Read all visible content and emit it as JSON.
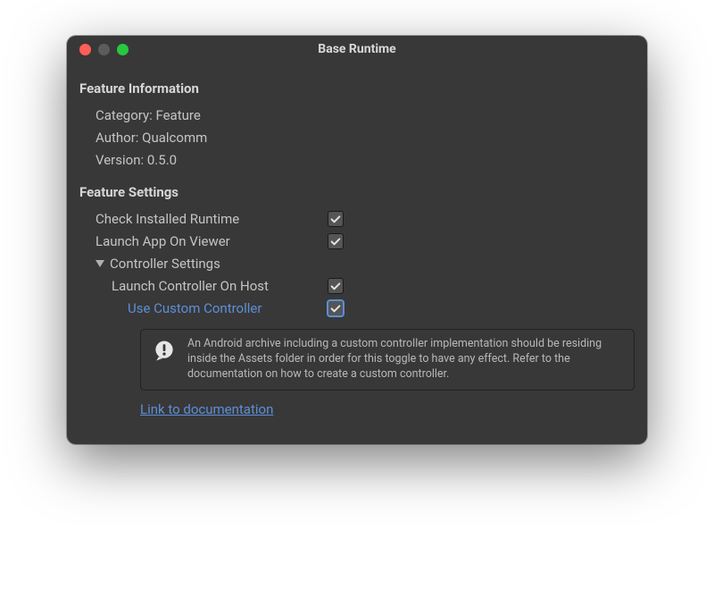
{
  "window": {
    "title": "Base Runtime"
  },
  "sections": {
    "info_header": "Feature Information",
    "settings_header": "Feature Settings"
  },
  "info": {
    "category_label": "Category:",
    "category_value": "Feature",
    "author_label": "Author:",
    "author_value": "Qualcomm",
    "version_label": "Version:",
    "version_value": "0.5.0"
  },
  "settings": {
    "check_runtime": {
      "label": "Check Installed Runtime",
      "checked": true
    },
    "launch_viewer": {
      "label": "Launch App On Viewer",
      "checked": true
    },
    "controller_foldout": {
      "label": "Controller Settings",
      "expanded": true
    },
    "launch_host": {
      "label": "Launch Controller On Host",
      "checked": true
    },
    "use_custom": {
      "label": "Use Custom Controller",
      "checked": true
    },
    "help_text": "An Android archive including a custom controller implementation should be residing inside the Assets folder in order for this toggle to have any effect. Refer to the documentation on how to create a custom controller.",
    "doc_link": "Link to documentation"
  }
}
